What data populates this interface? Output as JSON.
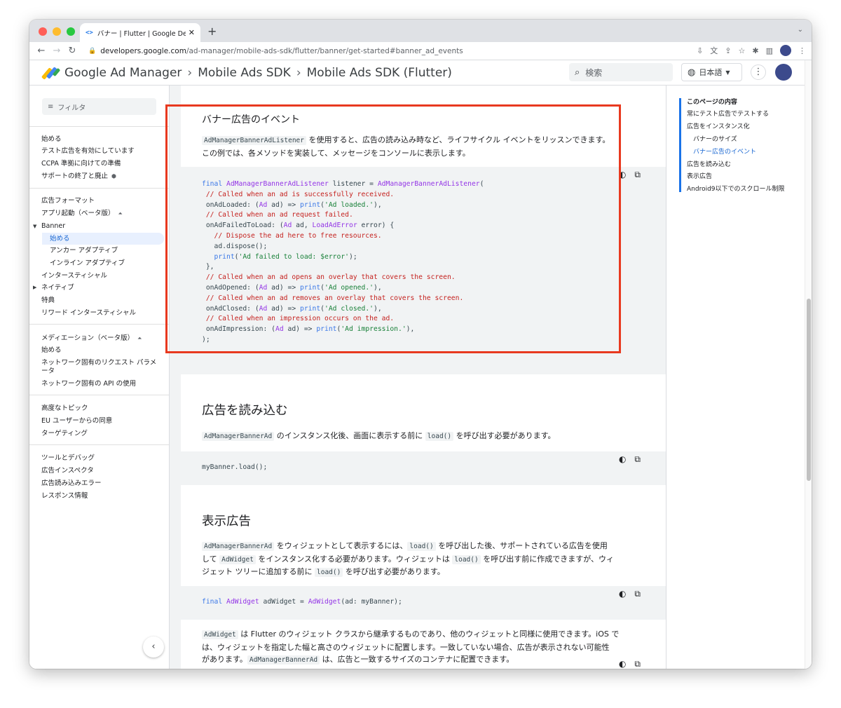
{
  "browser": {
    "tab_title": "バナー | Flutter | Google Developers",
    "url_domain": "developers.google.com",
    "url_path": "/ad-manager/mobile-ads-sdk/flutter/banner/get-started#banner_ad_events"
  },
  "header": {
    "brand": "Google Ad Manager",
    "crumb1": "Mobile Ads SDK",
    "crumb2": "Mobile Ads SDK (Flutter)",
    "search_placeholder": "検索",
    "language": "日本語"
  },
  "nav": {
    "filter_placeholder": "フィルタ",
    "s1": [
      "始める",
      "テスト広告を有効にしています",
      "CCPA 準拠に向けての準備",
      "サポートの終了と廃止"
    ],
    "formats": "広告フォーマット",
    "app_open": "アプリ起動（ベータ版）",
    "banner": "Banner",
    "banner_start": "始める",
    "anchor": "アンカー アダプティブ",
    "inline": "インライン アダプティブ",
    "interstitial": "インタースティシャル",
    "native": "ネイティブ",
    "rewarded": "特典",
    "rewarded_interstitial": "リワード インタースティシャル",
    "mediation": "メディエーション（ベータ版）",
    "med_start": "始める",
    "net_params_1": "ネットワーク固有のリクエスト パラメ",
    "net_params_2": "ータ",
    "net_api": "ネットワーク固有の API の使用",
    "advanced": "高度なトピック",
    "eu_consent": "EU ユーザーからの同意",
    "targeting": "ターゲティング",
    "tools": "ツールとデバッグ",
    "inspector": "広告インスペクタ",
    "load_errors": "広告読み込みエラー",
    "response_info": "レスポンス情報"
  },
  "content": {
    "events_title": "バナー広告のイベント",
    "events_code_term": "AdManagerBannerAdListener",
    "events_desc_1": " を使用すると、広告の読み込み時など、ライフサイクル イベントをリッスンできます。",
    "events_desc_2": "この例では、各メソッドを実装して、メッセージをコンソールに表示します。",
    "load_title": "広告を読み込む",
    "load_term1": "AdManagerBannerAd",
    "load_desc_mid": " のインスタンス化後、画面に表示する前に ",
    "load_term2": "load()",
    "load_desc_end": " を呼び出す必要があります。",
    "load_code": "myBanner.load();",
    "display_title": "表示広告",
    "display_p1": {
      "t1": "AdManagerBannerAd",
      "a": " をウィジェットとして表示するには、",
      "t2": "load()",
      "b": " を呼び出した後、サポートされている広告を使用",
      "c": "して ",
      "t3": "AdWidget",
      "d": " をインスタンス化する必要があります。ウィジェットは ",
      "t4": "load()",
      "e": " を呼び出す前に作成できますが、ウィ",
      "f": "ジェット ツリーに追加する前に ",
      "t5": "load()",
      "g": " を呼び出す必要があります。"
    },
    "display_p2": {
      "t1": "AdWidget",
      "a": " は Flutter のウィジェット クラスから継承するものであり、他のウィジェットと同様に使用できます。iOS で",
      "b": "は、ウィジェットを指定した幅と高さのウィジェットに配置します。一致していない場合、広告が表示されない可能性",
      "c": "があります。",
      "t2": "AdManagerBannerAd",
      "d": " は、広告と一致するサイズのコンテナに配置できます。"
    }
  },
  "toc": {
    "title": "このページの内容",
    "items": [
      "常にテスト広告でテストする",
      "広告をインスタンス化",
      "バナーのサイズ",
      "バナー広告のイベント",
      "広告を読み込む",
      "表示広告",
      "Android9以下でのスクロール制限"
    ]
  }
}
